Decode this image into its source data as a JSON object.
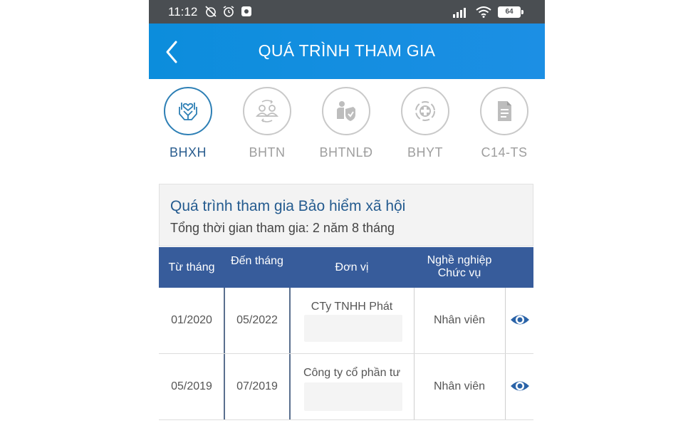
{
  "status_bar": {
    "time": "11:12",
    "battery": "64"
  },
  "header": {
    "title": "QUÁ TRÌNH THAM GIA"
  },
  "tabs": [
    {
      "label": "BHXH",
      "icon": "hands-heart-icon",
      "active": true
    },
    {
      "label": "BHTN",
      "icon": "people-exchange-icon",
      "active": false
    },
    {
      "label": "BHTNLĐ",
      "icon": "worker-shield-icon",
      "active": false
    },
    {
      "label": "BHYT",
      "icon": "medical-cross-icon",
      "active": false
    },
    {
      "label": "C14-TS",
      "icon": "document-icon",
      "active": false
    }
  ],
  "summary": {
    "title": "Quá trình tham gia Bảo hiểm xã hội",
    "total": "Tổng thời gian tham gia: 2 năm 8 tháng"
  },
  "table": {
    "headers": {
      "from": "Từ tháng",
      "to": "Đến tháng",
      "unit": "Đơn vị",
      "job_line1": "Nghề nghiệp",
      "job_line2": "Chức vụ"
    },
    "rows": [
      {
        "from": "01/2020",
        "to": "05/2022",
        "unit": "CTy TNHH Phát",
        "job": "Nhân viên"
      },
      {
        "from": "05/2019",
        "to": "07/2019",
        "unit": "Công ty cổ phần tư",
        "job": "Nhân viên"
      }
    ]
  },
  "colors": {
    "header_blue": "#1c8fe4",
    "table_header": "#375c9b",
    "active_tab": "#2d7fb5",
    "eye_icon": "#2a63a8"
  }
}
